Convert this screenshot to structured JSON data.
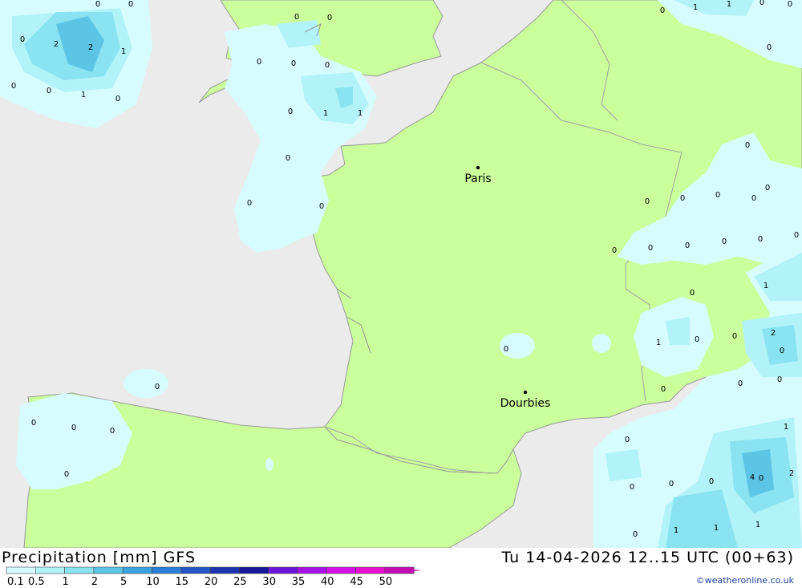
{
  "title": "Precipitation [mm] GFS",
  "datetime": "Tu 14-04-2026 12..15 UTC (00+63)",
  "credit": "©weatheronline.co.uk",
  "colors": {
    "sea": "#ebebeb",
    "land": "#caff9c",
    "border": "#999999",
    "precip_0_1": "#d7fcff",
    "precip_0_5": "#b2f3f9",
    "precip_1": "#8ae3f0",
    "precip_2": "#5cc5e6"
  },
  "legend": {
    "labels": [
      "0.1",
      "0.5",
      "1",
      "2",
      "5",
      "10",
      "15",
      "20",
      "25",
      "30",
      "35",
      "40",
      "45",
      "50"
    ],
    "colors": [
      "#d7fcff",
      "#b2f3f9",
      "#8ae3f0",
      "#5cc5e6",
      "#3aa3e0",
      "#2b7fd8",
      "#2554c7",
      "#1d34b0",
      "#17189a",
      "#6b16d9",
      "#a812e6",
      "#d70fe8",
      "#e80fd2",
      "#c40eb4"
    ]
  },
  "cities": [
    {
      "name": "Paris"
    },
    {
      "name": "Dourbies"
    }
  ],
  "values": [
    "0",
    "0",
    "0",
    "0",
    "2",
    "2",
    "1",
    "0",
    "0",
    "1",
    "0",
    "0",
    "0",
    "0",
    "0",
    "0",
    "0",
    "1",
    "1",
    "0",
    "0",
    "0",
    "0",
    "0",
    "0",
    "0",
    "0",
    "0",
    "1",
    "1",
    "0",
    "0",
    "0",
    "0",
    "0",
    "0",
    "0",
    "0",
    "0",
    "0",
    "0",
    "0",
    "0",
    "0",
    "0",
    "0",
    "0",
    "1",
    "0",
    "1",
    "0",
    "0",
    "2",
    "0",
    "0",
    "0",
    "1",
    "0",
    "4",
    "2",
    "0",
    "0",
    "0",
    "0",
    "1",
    "1",
    "1"
  ]
}
